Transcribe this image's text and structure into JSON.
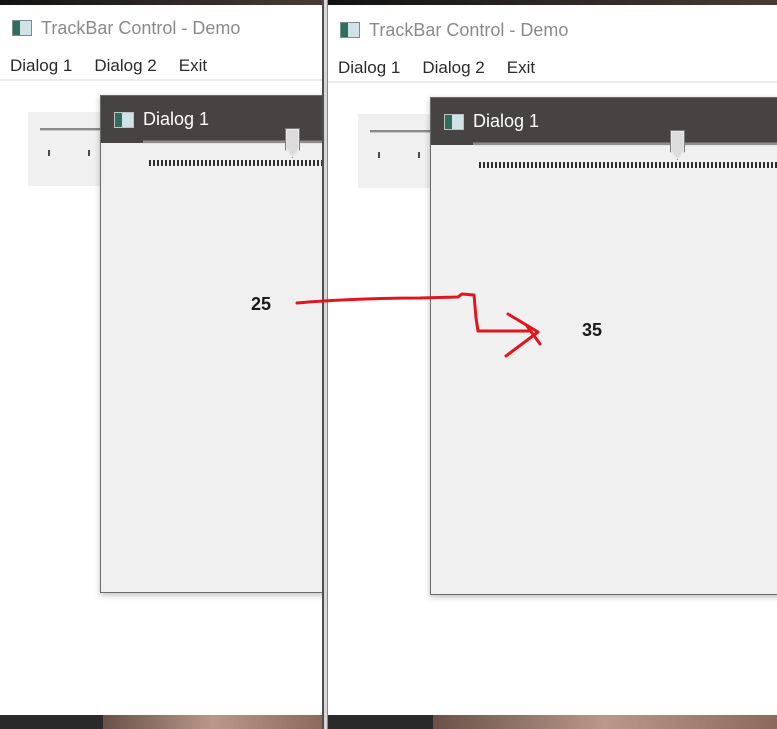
{
  "left_window": {
    "title": "TrackBar Control - Demo",
    "menu": [
      "Dialog 1",
      "Dialog 2",
      "Exit"
    ],
    "dialog": {
      "title": "Dialog 1",
      "slider_value": 25,
      "value_label": "25"
    }
  },
  "right_window": {
    "title": "TrackBar Control - Demo",
    "menu": [
      "Dialog 1",
      "Dialog 2",
      "Exit"
    ],
    "dialog": {
      "title": "Dialog 1",
      "slider_value": 35,
      "value_label": "35"
    }
  },
  "colors": {
    "dialog_titlebar": "#474343",
    "dialog_body": "#f0f0f0",
    "annotation_arrow": "#e0161e",
    "window_background": "#ffffff"
  },
  "icons": {
    "app": "app-window-icon",
    "dialog": "app-window-icon"
  }
}
